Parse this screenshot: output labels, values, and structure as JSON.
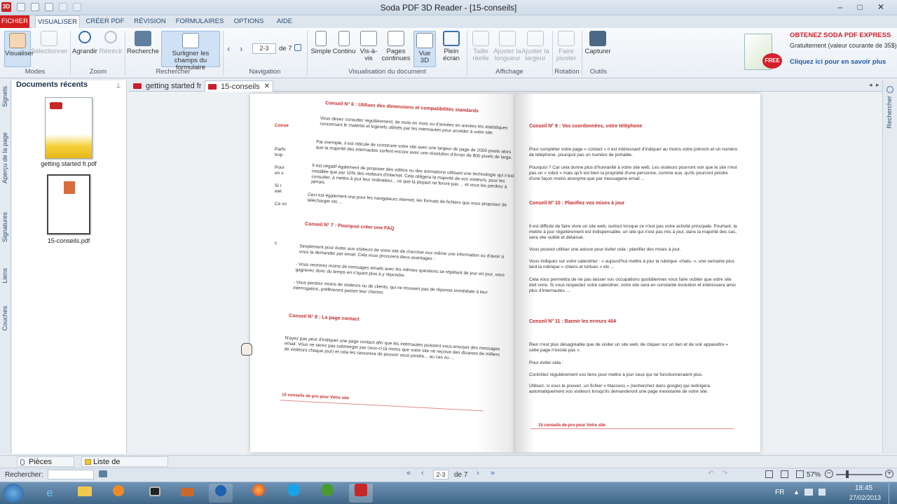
{
  "window": {
    "title": "Soda PDF 3D Reader - [15-conseils]"
  },
  "ribbon_tabs": [
    "FICHIER",
    "VISUALISER",
    "CRÉER PDF",
    "RÉVISION",
    "FORMULAIRES",
    "OPTIONS",
    "AIDE"
  ],
  "ribbon": {
    "modes": {
      "visualiser": "Visualiser",
      "selectionner": "Sélectionner",
      "group": "Modes"
    },
    "zoom": {
      "agrandir": "Agrandir",
      "retrecir": "Rétrécir",
      "group": "Zoom"
    },
    "rechercher": {
      "recherche": "Recherche",
      "surligner": "Surligner les champs du formulaire",
      "group": "Rechercher"
    },
    "navigation": {
      "page": "2-3",
      "of": "de 7",
      "group": "Navigation"
    },
    "vue": {
      "simple": "Simple",
      "continu": "Continu",
      "vis_a_vis": "Vis-à-vis",
      "pages_continues": "Pages continues",
      "vue3d": "Vue 3D",
      "plein_ecran": "Plein écran",
      "group": "Visualisation du document"
    },
    "affichage": {
      "taille_reelle": "Taille réelle",
      "ajuster_longueur": "Ajuster la longueur",
      "ajuster_largeur": "Ajuster la largeur",
      "group": "Affichage"
    },
    "rotation": {
      "faire_pivoter": "Faire pivoter",
      "group": "Rotation"
    },
    "outils": {
      "capturer": "Capturer",
      "group": "Outils"
    }
  },
  "ad": {
    "title": "OBTENEZ SODA PDF EXPRESS",
    "sub": "Gratuitement (valeur courante de 35$)",
    "link": "Cliquez ici pour en savoir plus",
    "badge": "FREE"
  },
  "sidebar": {
    "vertical_tabs": [
      "Signets",
      "Aperçu de la page",
      "Signatures",
      "Liens",
      "Couches"
    ],
    "title": "Documents récents",
    "docs": [
      {
        "name": "getting started fr.pdf"
      },
      {
        "name": "15-conseils.pdf"
      }
    ]
  },
  "doc_tabs": [
    {
      "name": "getting started fr"
    },
    {
      "name": "15-conseils"
    }
  ],
  "left_page": {
    "h6": "Conseil N° 6 : Utilisez des dimensions et compatibilités standards",
    "p6a": "Vous devez consulter régulièrement, de mois en mois ou d'années en années les statistiques concernant le matériel et logiciels utilisés par les internautes pour accéder à votre site.",
    "p6b": "Par exemple, il est ridicule de construire votre site avec une largeur de page de 2000 pixels alors que la majorité des internautes surfent encore avec une résolution d'écran de 800 pixels de large.",
    "p6c": "Il est négatif également de proposer des vidéos ou des animations utilisant une technologie qui n'est installée que par 10% des visiteurs d'internet. Cela obligera la majorité de vos visiteurs, pour les consulter, à mettre à jour leur ordinateur... ce que la plupart ne feront pas ... et vous les perdrez à jamais.",
    "p6d": "Ceci est également vrai pour les navigateurs internet, les formats de fichiers que vous proposez de télécharger etc ...",
    "h7": "Conseil N° 7 : Pourquoi créer une FAQ",
    "p7a": "Simplement pour éviter aux visiteurs de votre site de chercher eux même une information ou d'avoir à vous la demander par email. Cela vous procurera deux avantages :",
    "p7b": "- Vous recevrez moins de messages emails avec les mêmes questions se répétant de jour en jour, vous gagnerez donc du temps en n'ayant plus à y répondre.",
    "p7c": "- Vous perdrez moins de visiteurs ou de clients, qui ne trouvant pas de réponse immédiate à leur interrogation, préfèreront passer leur chemin.",
    "h8": "Conseil N° 8 : La page contact",
    "p8": "N'ayez pas peur d'indiquer une page contact afin que les internautes puissent vous envoyer des messages email. Vous ne serez pas submerger par ceux-ci (à moins que votre site ne reçoive des dizaines de milliers de visiteurs chaque jour) et cela les rassurera de pouvoir vous joindre... au cas ou ...",
    "footer": "15 conseils de pro pour Votre site",
    "peek": [
      "Conse",
      "Parfo trop .",
      "Pour en u",
      "Si r wel",
      "Ce so",
      "c"
    ]
  },
  "right_page": {
    "h9": "Conseil N° 9 : Vos coordonnées, votre téléphone",
    "p9a": "Pour compléter votre page « contact » il est intéressant d'indiquer au moins votre prénom et un numéro de téléphone, pourquoi pas un numéro de portable.",
    "p9b": "Pourquoi ? Car cela donne plus d'humanité à votre site web. Les visiteurs pourront voir que le site n'est pas un « robot » mais qu'il est bien la propriété d'une personne, comme eux, qu'ils pourront joindre d'une façon moins anonyme que par messagerie email ...",
    "h10": "Conseil N° 10 : Planifiez vos mises à jour",
    "p10a": "Il est difficile de faire vivre un site web, surtout lorsque ce n'est pas votre activité principale. Pourtant, la mettre à jour régulièrement est indispensable, un site qui n'est pas mis à jour, dans la majorité des cas, sera vite oublié et délaissé.",
    "p10b": "Vous pouvez utiliser une astuce pour éviter cela : planifier des mises à jour.",
    "p10c": "Vous indiquez sur votre calendrier : « aujourd'hui mettre à jour la rubrique -chats- », une semaine plus tard la rubrique « chiens et tortues » etc ...",
    "p10d": "Cela vous permettra de ne pas laisser vos occupations quotidiennes vous faire oublier que votre site doit vivre. Si vous respectez votre calendrier, votre site sera en constante évolution et intéressera ainsi plus d'internautes ...",
    "h11": "Conseil N° 11 : Bannir les erreurs 404",
    "p11a": "Rien n'est plus désagréable que de visiter un site web, de cliquer sur un lien et de voir apparaître « cette page n'existe pas ».",
    "p11b": "Pour éviter cela :",
    "p11c": "Contrôlez régulièrement vos liens pour mettre à jour ceux qui ne fonctionneraient plus.",
    "p11d": "Utilisez, si vous le pouvez, un fichier « htaccess » (recherchez dans google) qui redirigera automatiquement vos visiteurs lorsqu'ils demanderont une page inexistante de votre site.",
    "footer": "15 conseils de pro pour Votre site"
  },
  "bottom_tabs": {
    "pieces": "Pièces jointes",
    "comments": "Liste de commentaires"
  },
  "status": {
    "search_label": "Rechercher:",
    "page": "2-3",
    "of": "de 7",
    "zoom": "57%"
  },
  "taskbar": {
    "lang": "FR",
    "time": "18:45",
    "date": "27/02/2013"
  }
}
